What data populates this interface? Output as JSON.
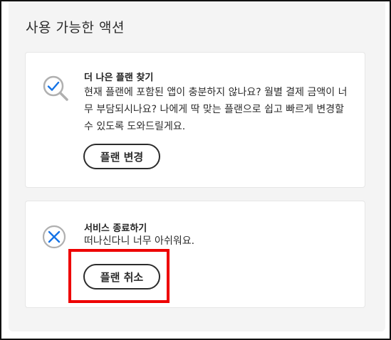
{
  "panel": {
    "title": "사용 가능한 액션"
  },
  "plan_card": {
    "icon": "magnifier-check-icon",
    "heading": "더 나은 플랜 찾기",
    "description": "현재 플랜에 포함된 앱이 충분하지 않나요? 월별 결제 금액이 너무 부담되시나요? 나에게 딱 맞는 플랜으로 쉽고 빠르게 변경할 수 있도록 도와드릴게요.",
    "button_label": "플랜 변경"
  },
  "cancel_card": {
    "icon": "circle-x-icon",
    "heading": "서비스 종료하기",
    "description": "떠나신다니 너무 아쉬워요.",
    "button_label": "플랜 취소"
  },
  "colors": {
    "accent_blue": "#1473e6",
    "highlight_red": "#ee0000",
    "panel_bg": "#f4f4f4"
  }
}
